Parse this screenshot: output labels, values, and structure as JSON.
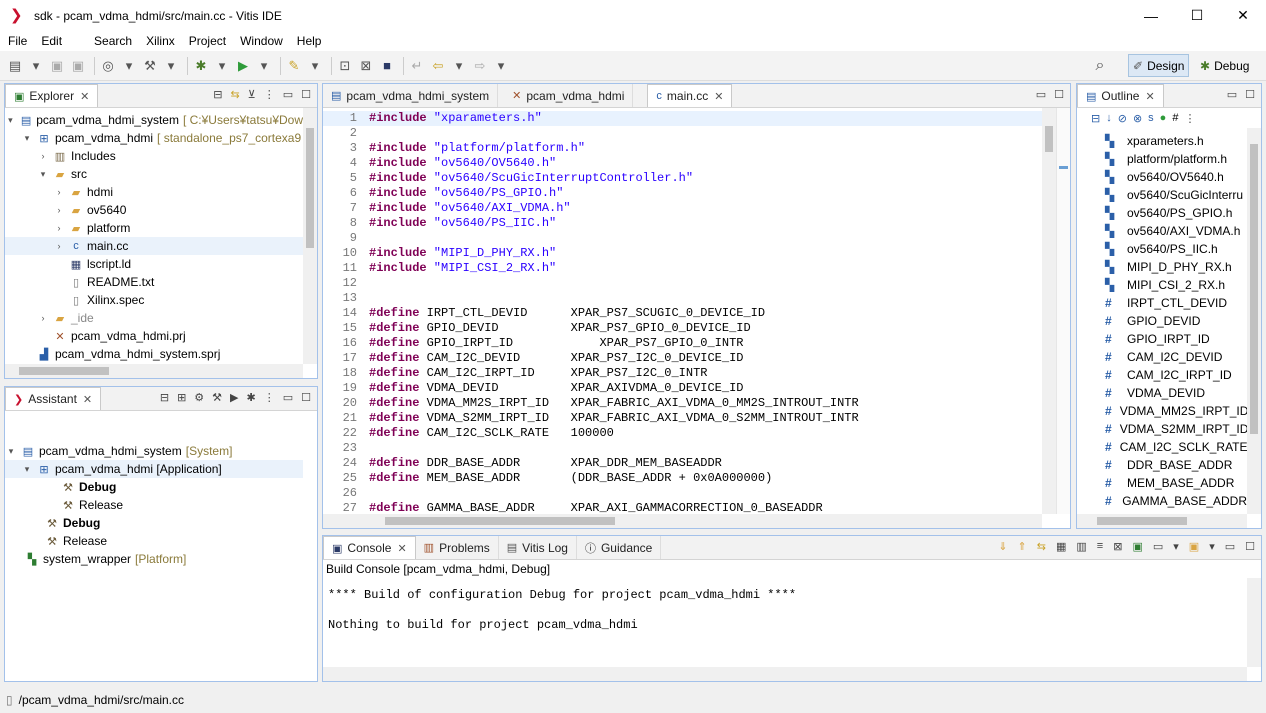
{
  "window": {
    "title": "sdk - pcam_vdma_hdmi/src/main.cc - Vitis IDE",
    "minimize": "—",
    "maximize": "☐",
    "close": "✕"
  },
  "menu": [
    "File",
    "Edit",
    "Search",
    "Xilinx",
    "Project",
    "Window",
    "Help"
  ],
  "perspectives": {
    "design": "Design",
    "debug": "Debug"
  },
  "explorer": {
    "title": "Explorer",
    "items": [
      {
        "label": "pcam_vdma_hdmi_system",
        "decor": "[ C:¥Users¥tatsu¥Dow"
      },
      {
        "label": "pcam_vdma_hdmi",
        "decor": "[ standalone_ps7_cortexa9"
      },
      {
        "label": "Includes",
        "decor": ""
      },
      {
        "label": "src",
        "decor": ""
      },
      {
        "label": "hdmi",
        "decor": ""
      },
      {
        "label": "ov5640",
        "decor": ""
      },
      {
        "label": "platform",
        "decor": ""
      },
      {
        "label": "main.cc",
        "decor": ""
      },
      {
        "label": "lscript.ld",
        "decor": ""
      },
      {
        "label": "README.txt",
        "decor": ""
      },
      {
        "label": "Xilinx.spec",
        "decor": ""
      },
      {
        "label": "_ide",
        "decor": ""
      },
      {
        "label": "pcam_vdma_hdmi.prj",
        "decor": ""
      },
      {
        "label": "pcam_vdma_hdmi_system.sprj",
        "decor": ""
      }
    ]
  },
  "assistant": {
    "title": "Assistant",
    "items": [
      {
        "label": "pcam_vdma_hdmi_system",
        "decor": "[System]"
      },
      {
        "label": "pcam_vdma_hdmi [Application]",
        "decor": ""
      },
      {
        "label": "Debug",
        "decor": ""
      },
      {
        "label": "Release",
        "decor": ""
      },
      {
        "label": "Debug",
        "decor": ""
      },
      {
        "label": "Release",
        "decor": ""
      },
      {
        "label": "system_wrapper",
        "decor": "[Platform]"
      }
    ]
  },
  "editor": {
    "tabs": [
      {
        "label": "pcam_vdma_hdmi_system"
      },
      {
        "label": "pcam_vdma_hdmi"
      },
      {
        "label": "main.cc"
      }
    ],
    "lines": [
      {
        "n": "1",
        "kw": "#include",
        "rest": " \"xparameters.h\""
      },
      {
        "n": "2",
        "kw": "",
        "rest": ""
      },
      {
        "n": "3",
        "kw": "#include",
        "rest": " \"platform/platform.h\""
      },
      {
        "n": "4",
        "kw": "#include",
        "rest": " \"ov5640/OV5640.h\""
      },
      {
        "n": "5",
        "kw": "#include",
        "rest": " \"ov5640/ScuGicInterruptController.h\""
      },
      {
        "n": "6",
        "kw": "#include",
        "rest": " \"ov5640/PS_GPIO.h\""
      },
      {
        "n": "7",
        "kw": "#include",
        "rest": " \"ov5640/AXI_VDMA.h\""
      },
      {
        "n": "8",
        "kw": "#include",
        "rest": " \"ov5640/PS_IIC.h\""
      },
      {
        "n": "9",
        "kw": "",
        "rest": ""
      },
      {
        "n": "10",
        "kw": "#include",
        "rest": " \"MIPI_D_PHY_RX.h\""
      },
      {
        "n": "11",
        "kw": "#include",
        "rest": " \"MIPI_CSI_2_RX.h\""
      },
      {
        "n": "12",
        "kw": "",
        "rest": ""
      },
      {
        "n": "13",
        "kw": "",
        "rest": ""
      },
      {
        "n": "14",
        "kw": "#define",
        "rest": " IRPT_CTL_DEVID      XPAR_PS7_SCUGIC_0_DEVICE_ID"
      },
      {
        "n": "15",
        "kw": "#define",
        "rest": " GPIO_DEVID          XPAR_PS7_GPIO_0_DEVICE_ID"
      },
      {
        "n": "16",
        "kw": "#define",
        "rest": " GPIO_IRPT_ID            XPAR_PS7_GPIO_0_INTR"
      },
      {
        "n": "17",
        "kw": "#define",
        "rest": " CAM_I2C_DEVID       XPAR_PS7_I2C_0_DEVICE_ID"
      },
      {
        "n": "18",
        "kw": "#define",
        "rest": " CAM_I2C_IRPT_ID     XPAR_PS7_I2C_0_INTR"
      },
      {
        "n": "19",
        "kw": "#define",
        "rest": " VDMA_DEVID          XPAR_AXIVDMA_0_DEVICE_ID"
      },
      {
        "n": "20",
        "kw": "#define",
        "rest": " VDMA_MM2S_IRPT_ID   XPAR_FABRIC_AXI_VDMA_0_MM2S_INTROUT_INTR"
      },
      {
        "n": "21",
        "kw": "#define",
        "rest": " VDMA_S2MM_IRPT_ID   XPAR_FABRIC_AXI_VDMA_0_S2MM_INTROUT_INTR"
      },
      {
        "n": "22",
        "kw": "#define",
        "rest": " CAM_I2C_SCLK_RATE   100000"
      },
      {
        "n": "23",
        "kw": "",
        "rest": ""
      },
      {
        "n": "24",
        "kw": "#define",
        "rest": " DDR_BASE_ADDR       XPAR_DDR_MEM_BASEADDR"
      },
      {
        "n": "25",
        "kw": "#define",
        "rest": " MEM_BASE_ADDR       (DDR_BASE_ADDR + 0x0A000000)"
      },
      {
        "n": "26",
        "kw": "",
        "rest": ""
      },
      {
        "n": "27",
        "kw": "#define",
        "rest": " GAMMA_BASE_ADDR     XPAR_AXI_GAMMACORRECTION_0_BASEADDR"
      }
    ]
  },
  "outline": {
    "title": "Outline",
    "items": [
      {
        "icon": "include",
        "label": "xparameters.h"
      },
      {
        "icon": "include",
        "label": "platform/platform.h"
      },
      {
        "icon": "include",
        "label": "ov5640/OV5640.h"
      },
      {
        "icon": "include",
        "label": "ov5640/ScuGicInterru"
      },
      {
        "icon": "include",
        "label": "ov5640/PS_GPIO.h"
      },
      {
        "icon": "include",
        "label": "ov5640/AXI_VDMA.h"
      },
      {
        "icon": "include",
        "label": "ov5640/PS_IIC.h"
      },
      {
        "icon": "include",
        "label": "MIPI_D_PHY_RX.h"
      },
      {
        "icon": "include",
        "label": "MIPI_CSI_2_RX.h"
      },
      {
        "icon": "define",
        "label": "IRPT_CTL_DEVID"
      },
      {
        "icon": "define",
        "label": "GPIO_DEVID"
      },
      {
        "icon": "define",
        "label": "GPIO_IRPT_ID"
      },
      {
        "icon": "define",
        "label": "CAM_I2C_DEVID"
      },
      {
        "icon": "define",
        "label": "CAM_I2C_IRPT_ID"
      },
      {
        "icon": "define",
        "label": "VDMA_DEVID"
      },
      {
        "icon": "define",
        "label": "VDMA_MM2S_IRPT_ID"
      },
      {
        "icon": "define",
        "label": "VDMA_S2MM_IRPT_ID"
      },
      {
        "icon": "define",
        "label": "CAM_I2C_SCLK_RATE"
      },
      {
        "icon": "define",
        "label": "DDR_BASE_ADDR"
      },
      {
        "icon": "define",
        "label": "MEM_BASE_ADDR"
      },
      {
        "icon": "define",
        "label": "GAMMA_BASE_ADDR"
      }
    ]
  },
  "console": {
    "tabs": [
      {
        "label": "Console"
      },
      {
        "label": "Problems"
      },
      {
        "label": "Vitis Log"
      },
      {
        "label": "Guidance"
      }
    ],
    "header": "Build Console [pcam_vdma_hdmi, Debug]",
    "line1": "**** Build of configuration Debug for project pcam_vdma_hdmi ****",
    "line2": "Nothing to build for project pcam_vdma_hdmi"
  },
  "status": {
    "path": "/pcam_vdma_hdmi/src/main.cc"
  }
}
